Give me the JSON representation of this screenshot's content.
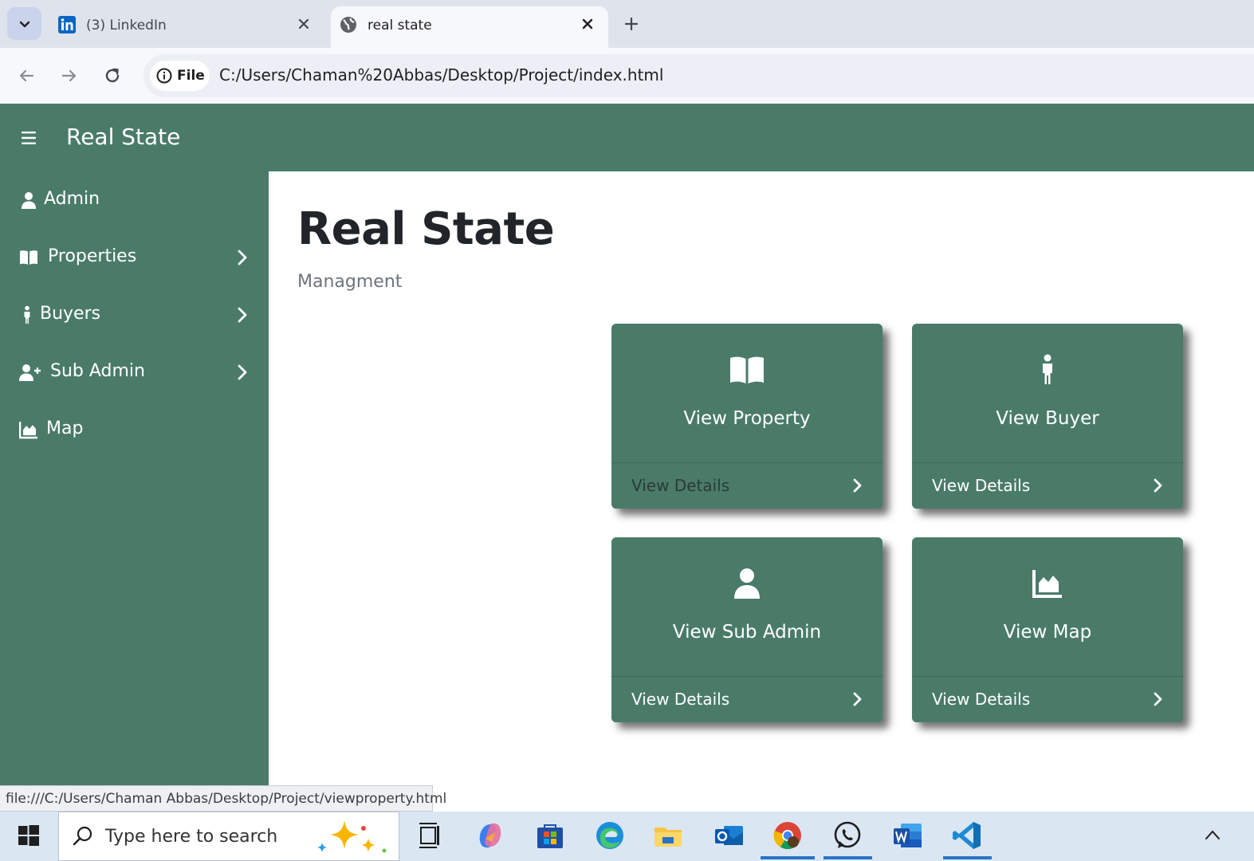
{
  "browser": {
    "tabs": [
      {
        "title": "(3) LinkedIn",
        "active": false,
        "favicon": "linkedin-icon"
      },
      {
        "title": "real state",
        "active": true,
        "favicon": "globe-icon"
      }
    ],
    "site_info_label": "File",
    "url": "C:/Users/Chaman%20Abbas/Desktop/Project/index.html",
    "status_url": "file:///C:/Users/Chaman Abbas/Desktop/Project/viewproperty.html"
  },
  "app": {
    "brand": "Real State",
    "colors": {
      "primary": "#4a7b69",
      "text_dark": "#212529",
      "muted": "#6c757d"
    }
  },
  "sidebar": {
    "items": [
      {
        "label": "Admin",
        "icon": "user-icon",
        "has_submenu": false
      },
      {
        "label": "Properties",
        "icon": "book-open-icon",
        "has_submenu": true
      },
      {
        "label": "Buyers",
        "icon": "person-standing-icon",
        "has_submenu": true
      },
      {
        "label": "Sub Admin",
        "icon": "user-plus-icon",
        "has_submenu": true
      },
      {
        "label": "Map",
        "icon": "area-chart-icon",
        "has_submenu": false
      }
    ]
  },
  "main": {
    "title": "Real State",
    "subtitle": "Managment",
    "cards": [
      {
        "title": "View Property",
        "link": "View Details",
        "icon": "book-open-icon"
      },
      {
        "title": "View Buyer",
        "link": "View Details",
        "icon": "person-standing-icon"
      },
      {
        "title": "View Sub Admin",
        "link": "View Details",
        "icon": "user-icon"
      },
      {
        "title": "View Map",
        "link": "View Details",
        "icon": "area-chart-icon"
      }
    ]
  },
  "taskbar": {
    "search_placeholder": "Type here to search",
    "apps": [
      "task-view-icon",
      "copilot-icon",
      "microsoft-store-icon",
      "edge-icon",
      "file-explorer-icon",
      "outlook-icon",
      "chrome-icon",
      "whatsapp-icon",
      "word-icon",
      "vscode-icon"
    ]
  }
}
